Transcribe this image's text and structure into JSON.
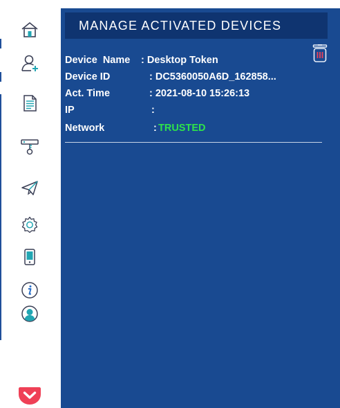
{
  "header": {
    "title": "MANAGE ACTIVATED DEVICES"
  },
  "device": {
    "name_label": "Device  Name",
    "name_value": ": Desktop Token",
    "id_label": "Device ID",
    "id_value": ": DC5360050A6D_162858...",
    "time_label": "Act. Time",
    "time_value": ": 2021-08-10 15:26:13",
    "ip_label": "IP",
    "ip_value": ":",
    "network_label": "Network",
    "network_colon": ":",
    "network_value": "TRUSTED"
  },
  "colors": {
    "panel": "#194a91",
    "header": "#0f3470",
    "trusted": "#2ee34a",
    "icon_accent": "#22a6b3",
    "pocket": "#ef4056"
  },
  "sidebar": {
    "icons": [
      "home-icon",
      "add-user-icon",
      "document-icon",
      "key-icon",
      "send-icon",
      "settings-icon",
      "mobile-device-icon",
      "info-icon",
      "user-profile-icon"
    ],
    "bottom_icon": "pocket-icon"
  }
}
